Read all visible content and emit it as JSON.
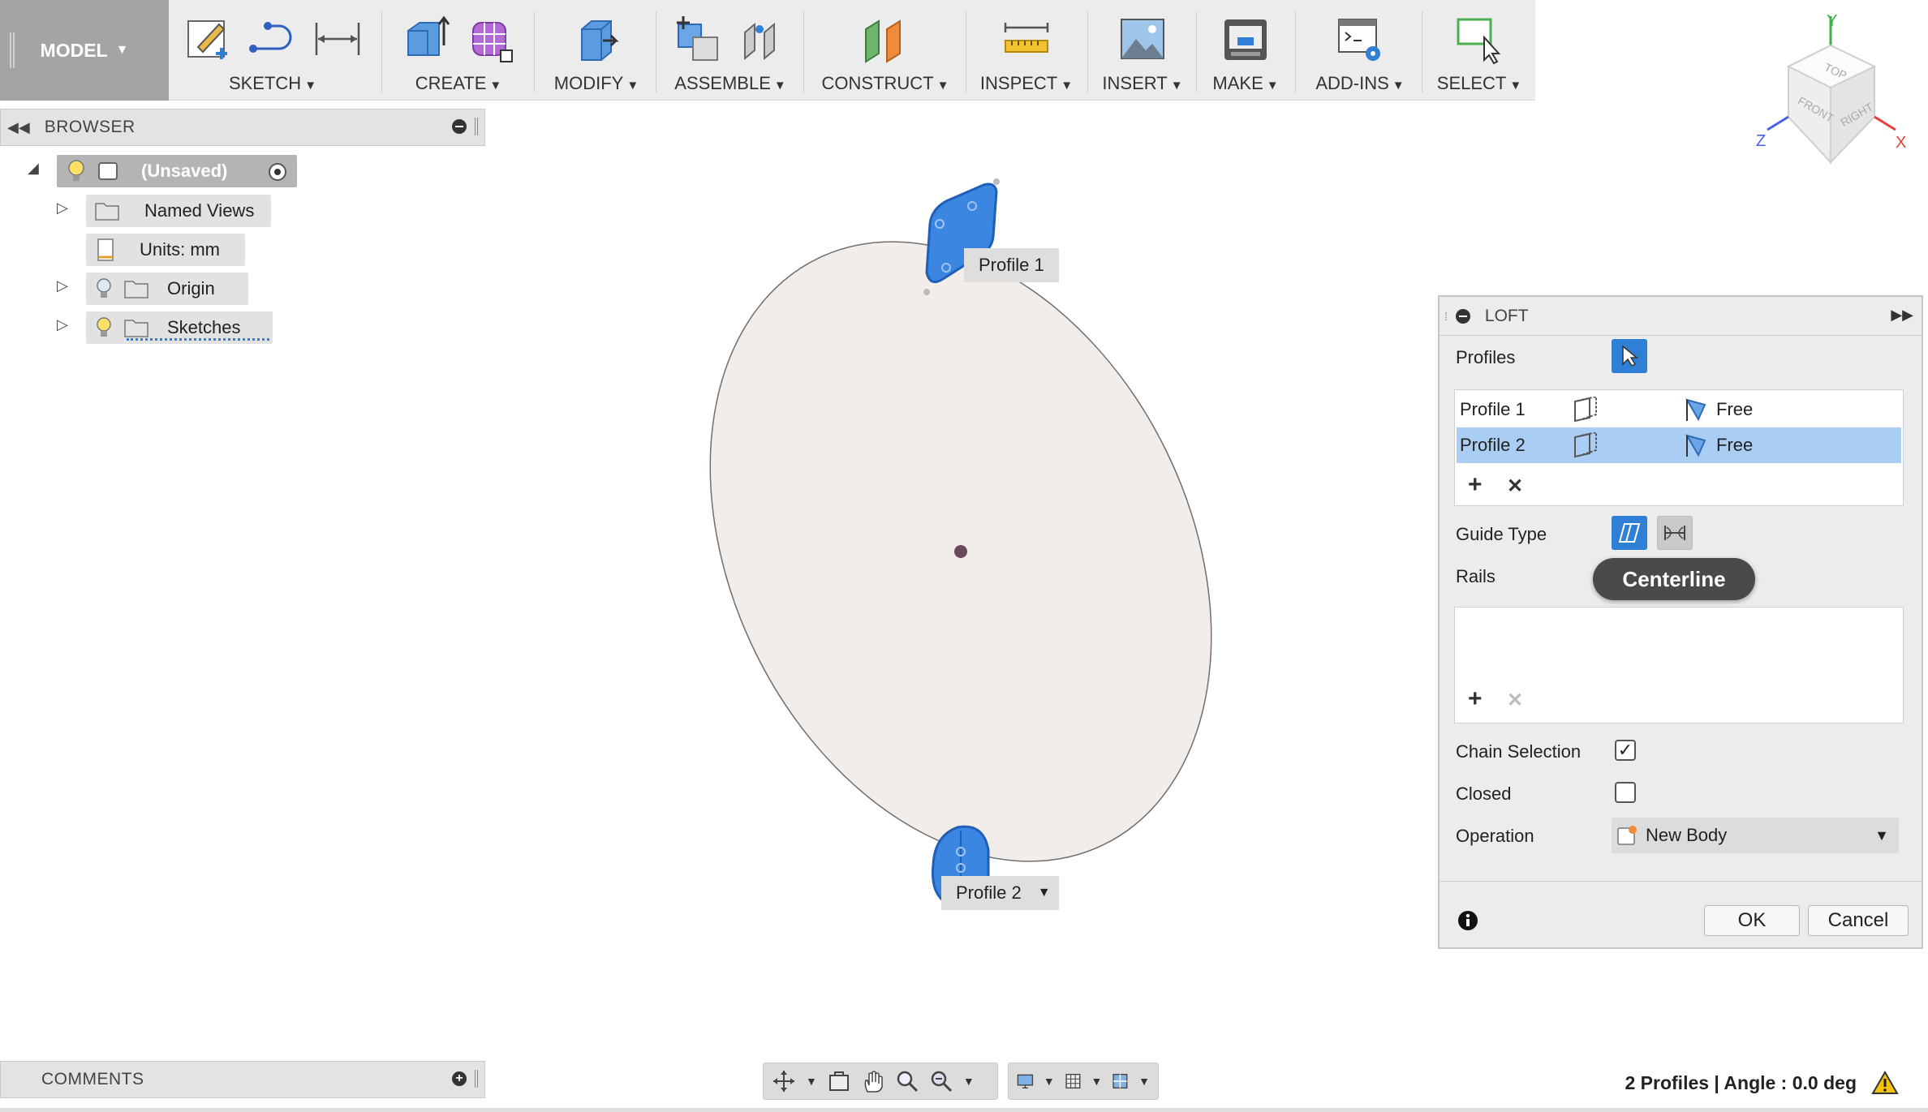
{
  "toolbar": {
    "model_label": "MODEL",
    "groups": [
      {
        "id": "sketch",
        "label": "SKETCH"
      },
      {
        "id": "create",
        "label": "CREATE"
      },
      {
        "id": "modify",
        "label": "MODIFY"
      },
      {
        "id": "assemble",
        "label": "ASSEMBLE"
      },
      {
        "id": "construct",
        "label": "CONSTRUCT"
      },
      {
        "id": "inspect",
        "label": "INSPECT"
      },
      {
        "id": "insert",
        "label": "INSERT"
      },
      {
        "id": "make",
        "label": "MAKE"
      },
      {
        "id": "addins",
        "label": "ADD-INS"
      },
      {
        "id": "select",
        "label": "SELECT"
      }
    ]
  },
  "browser": {
    "title": "BROWSER",
    "root": "(Unsaved)",
    "items": [
      {
        "label": "Named Views"
      },
      {
        "label": "Units: mm"
      },
      {
        "label": "Origin"
      },
      {
        "label": "Sketches"
      }
    ]
  },
  "comments": {
    "title": "COMMENTS"
  },
  "viewcube": {
    "faces": [
      "TOP",
      "FRONT",
      "RIGHT"
    ],
    "axes": [
      "X",
      "Y",
      "Z"
    ]
  },
  "canvas": {
    "profile1_label": "Profile 1",
    "profile2_label": "Profile 2"
  },
  "loft": {
    "title": "LOFT",
    "profiles_label": "Profiles",
    "profiles": [
      {
        "name": "Profile 1",
        "condition": "Free",
        "selected": false
      },
      {
        "name": "Profile 2",
        "condition": "Free",
        "selected": true
      }
    ],
    "guide_type_label": "Guide Type",
    "rails_label": "Rails",
    "tooltip": "Centerline",
    "chain_selection_label": "Chain Selection",
    "chain_selection_checked": true,
    "closed_label": "Closed",
    "closed_checked": false,
    "operation_label": "Operation",
    "operation_value": "New Body",
    "ok_label": "OK",
    "cancel_label": "Cancel"
  },
  "status": {
    "text": "2 Profiles | Angle : 0.0 deg"
  },
  "colors": {
    "accent_blue": "#2f7fd6",
    "profile_fill": "#3a86e0",
    "selected_row": "#a9cdf3",
    "annotation_arrow": "#ee1c1c",
    "sketch_fill": "#f2ede9"
  }
}
